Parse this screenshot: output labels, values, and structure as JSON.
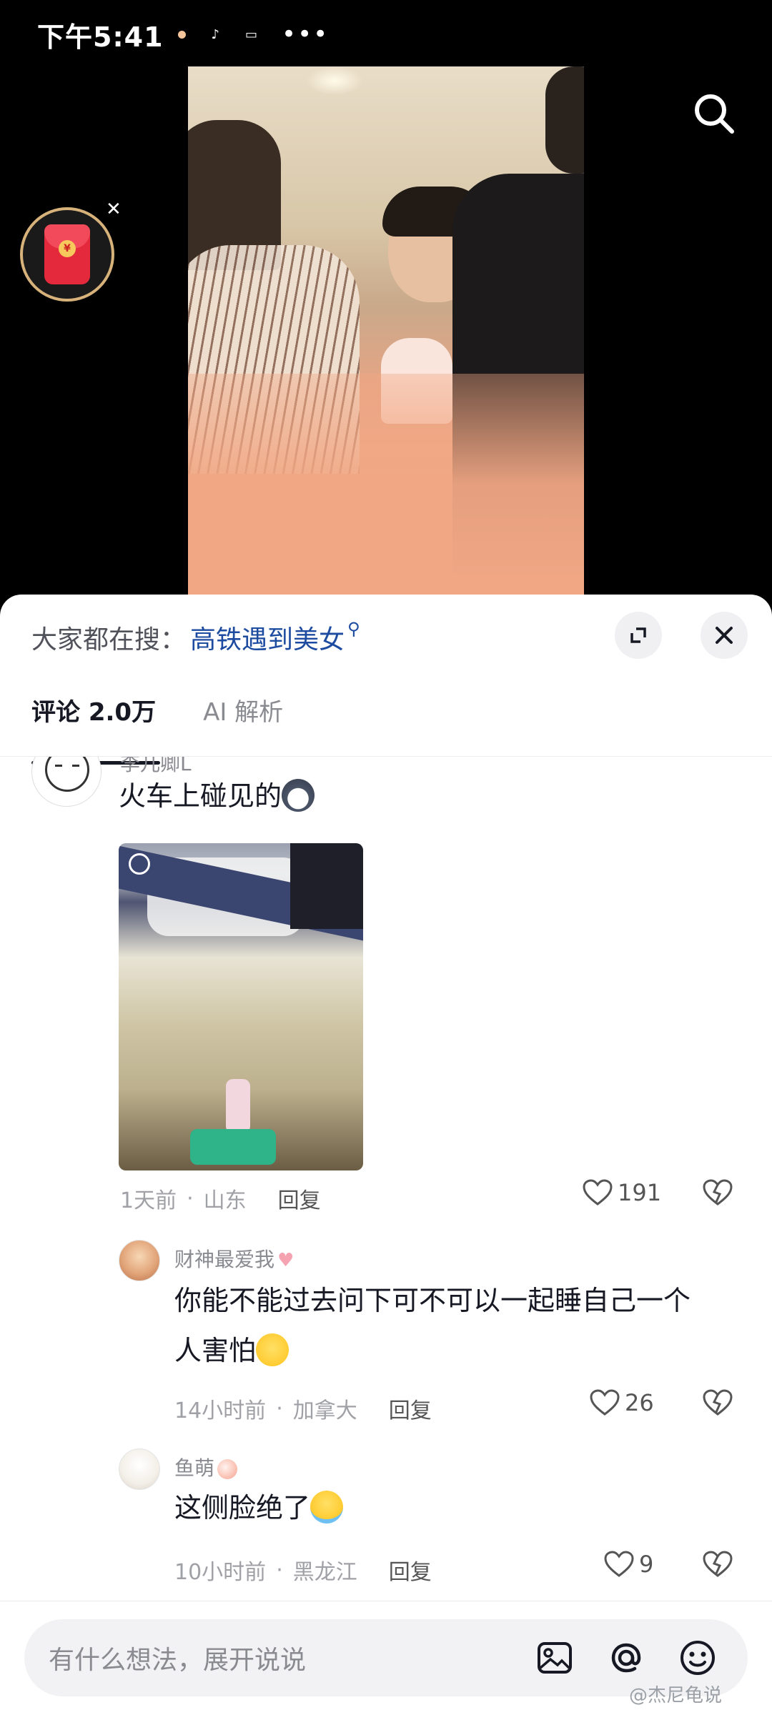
{
  "status_bar": {
    "time": "下午5:41",
    "more": "•••"
  },
  "hot_search": {
    "prefix": "大家都在搜：",
    "keyword": "高铁遇到美女"
  },
  "tabs": [
    {
      "label": "评论 2.0万",
      "active": true
    },
    {
      "label": "AI 解析",
      "active": false
    }
  ],
  "comments": [
    {
      "username": "李儿卿L",
      "text": "火车上碰见的",
      "time": "1天前",
      "location": "山东",
      "reply_label": "回复",
      "likes": "191",
      "has_image": true
    },
    {
      "username": "财神最爱我",
      "text_line1": "你能不能过去问下可不可以一起睡自己一个",
      "text_line2": "人害怕",
      "time": "14小时前",
      "location": "加拿大",
      "reply_label": "回复",
      "likes": "26"
    },
    {
      "username": "鱼萌",
      "text": "这侧脸绝了",
      "time": "10小时前",
      "location": "黑龙江",
      "reply_label": "回复",
      "likes": "9"
    }
  ],
  "input": {
    "placeholder": "有什么想法，展开说说"
  },
  "watermark": "@杰尼龟说",
  "colors": {
    "keyword": "#1d4ba0",
    "text": "#161823",
    "muted": "#8a8b91",
    "redpacket": "#e5293d"
  },
  "icons": [
    "search-icon",
    "redpacket-icon",
    "close-icon",
    "expand-icon",
    "heart-icon",
    "dislike-icon",
    "image-icon",
    "at-icon",
    "emoji-icon"
  ]
}
